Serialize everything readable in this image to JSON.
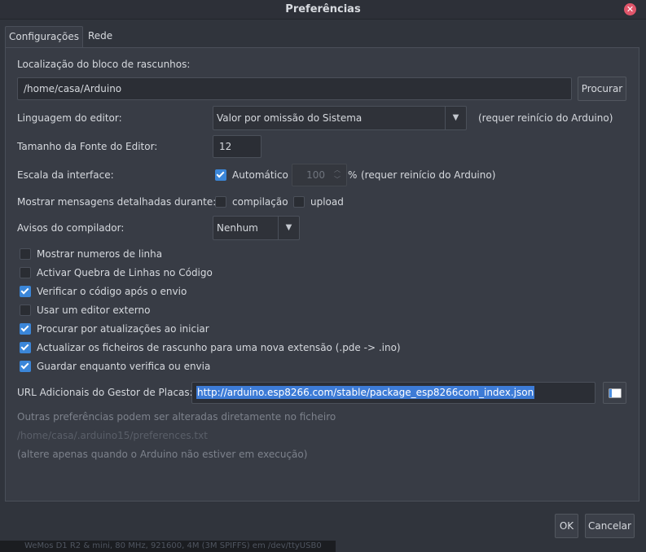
{
  "window": {
    "title": "Preferências"
  },
  "tabs": [
    {
      "label": "Configurações",
      "active": true
    },
    {
      "label": "Rede",
      "active": false
    }
  ],
  "sketchbook": {
    "label": "Localização do bloco de rascunhos:",
    "path": "/home/casa/Arduino",
    "browse_label": "Procurar"
  },
  "language": {
    "label": "Linguagem do editor:",
    "value": "Valor por omissão do Sistema",
    "note": "(requer reinício do Arduino)"
  },
  "font_size": {
    "label": "Tamanho da Fonte do Editor:",
    "value": "12"
  },
  "scale": {
    "label": "Escala da interface:",
    "auto_label": "Automático",
    "auto_checked": true,
    "value": "100",
    "unit": "%",
    "note": "(requer reinício do Arduino)"
  },
  "verbose": {
    "label": "Mostrar mensagens detalhadas durante:",
    "compile_label": "compilação",
    "compile_checked": false,
    "upload_label": "upload",
    "upload_checked": false
  },
  "warnings": {
    "label": "Avisos do compilador:",
    "value": "Nenhum"
  },
  "options": [
    {
      "label": "Mostrar numeros de linha",
      "checked": false
    },
    {
      "label": "Activar Quebra de Linhas no Código",
      "checked": false
    },
    {
      "label": "Verificar o código após o envio",
      "checked": true
    },
    {
      "label": "Usar um editor externo",
      "checked": false
    },
    {
      "label": "Procurar por atualizações ao iniciar",
      "checked": true
    },
    {
      "label": "Actualizar os ficheiros de rascunho para uma nova extensão (.pde -> .ino)",
      "checked": true
    },
    {
      "label": "Guardar enquanto verifica ou envia",
      "checked": true
    }
  ],
  "board_urls": {
    "label": "URL Adicionais do Gestor de Placas:",
    "value": "http://arduino.esp8266.com/stable/package_esp8266com_index.json"
  },
  "info": {
    "line1": "Outras preferências podem ser alteradas diretamente no ficheiro",
    "line2": "/home/casa/.arduino15/preferences.txt",
    "line3": "(altere apenas quando o Arduino não estiver em execução)"
  },
  "buttons": {
    "ok": "OK",
    "cancel": "Cancelar"
  },
  "status_strip": "WeMos D1 R2 & mini, 80 MHz, 921600, 4M (3M SPIFFS) em /dev/ttyUSB0",
  "colors": {
    "accent": "#3b86d8",
    "background": "#30343c",
    "panel": "#383c45"
  }
}
